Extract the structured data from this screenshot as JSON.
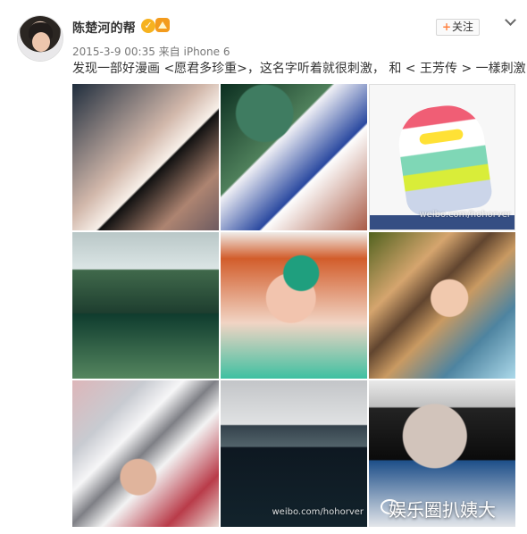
{
  "post": {
    "author": "陈楚河的帮",
    "meta": "2015-3-9 00:35 来自 iPhone 6",
    "text": "发现一部好漫画 <愿君多珍重>，这名字听着就很刺激， 和 < 王芳传 > 一樣刺激",
    "follow_label": "关注",
    "watermark": "娱乐圈扒姨大"
  },
  "icons": {
    "verified": "verified-icon",
    "crown": "crown-icon",
    "more": "more-icon",
    "follow_plus": "plus-icon"
  },
  "photos": {
    "items": [
      {
        "name": "photo-1"
      },
      {
        "name": "photo-2"
      },
      {
        "name": "photo-3"
      },
      {
        "name": "photo-4"
      },
      {
        "name": "photo-5"
      },
      {
        "name": "photo-6"
      },
      {
        "name": "photo-7"
      },
      {
        "name": "photo-8"
      },
      {
        "name": "photo-9"
      }
    ],
    "watermark_small": "weibo.com/hohorver",
    "watermark_blog": "weibo.com/hohorver"
  },
  "colors": {
    "text": "#333333",
    "meta": "#777777",
    "follow_accent": "#ff8140",
    "verified": "#f6b21f"
  }
}
